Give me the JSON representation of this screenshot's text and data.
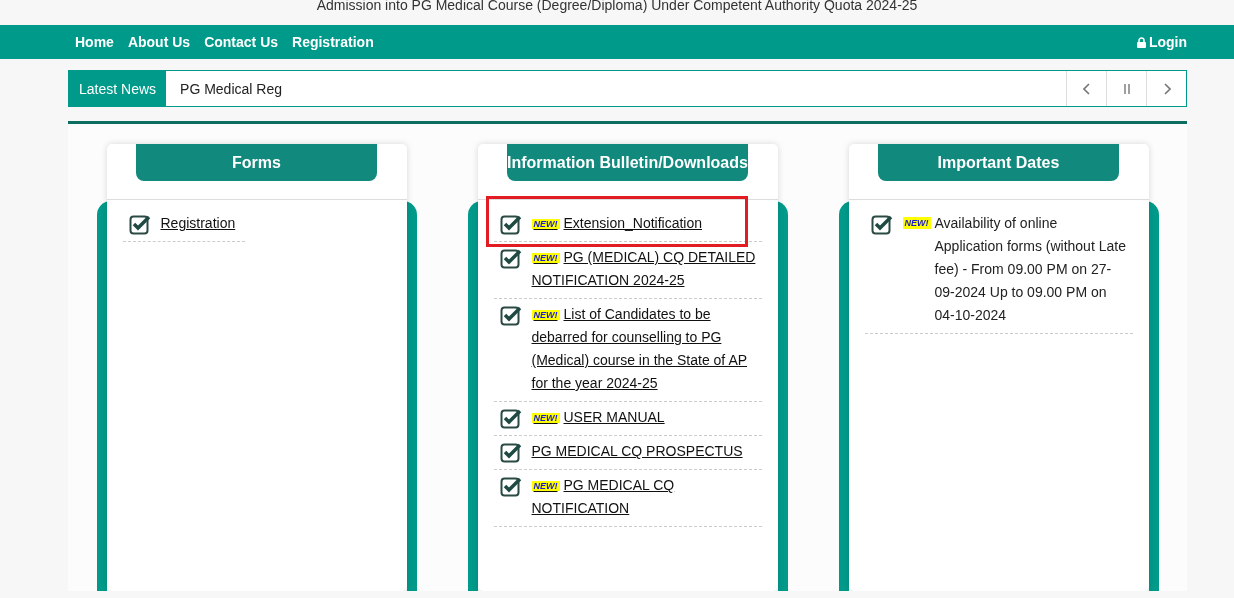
{
  "page_title": "Admission into PG Medical Course (Degree/Diploma) Under Competent Authority Quota 2024-25",
  "nav": {
    "links": [
      "Home",
      "About Us",
      "Contact Us",
      "Registration"
    ],
    "login": "Login"
  },
  "news": {
    "label": "Latest News",
    "text": "PG Medical Reg",
    "controls": [
      {
        "kind": "prev"
      },
      {
        "kind": "pause"
      },
      {
        "kind": "next"
      }
    ]
  },
  "cards": [
    {
      "title": "Forms",
      "items": [
        {
          "text": "Registration",
          "link": true,
          "highlighted": false
        }
      ]
    },
    {
      "title": "Information Bulletin/Downloads",
      "items": [
        {
          "text": "Extension_Notification",
          "link": true,
          "badge": "NEW!",
          "highlighted": true
        },
        {
          "text": "PG (MEDICAL) CQ DETAILED NOTIFICATION 2024-25",
          "link": true,
          "badge": "NEW!",
          "highlighted": false
        },
        {
          "text": "List of Candidates to be debarred for counselling to PG (Medical) course in the State of AP for the year 2024-25",
          "link": true,
          "badge": "NEW!",
          "highlighted": false
        },
        {
          "text": "USER MANUAL",
          "link": true,
          "badge": "NEW!",
          "highlighted": false
        },
        {
          "text": "PG MEDICAL CQ PROSPECTUS",
          "link": true,
          "highlighted": false
        },
        {
          "text": "PG MEDICAL CQ NOTIFICATION",
          "link": true,
          "badge": "NEW!",
          "highlighted": false
        }
      ]
    },
    {
      "title": "Important Dates",
      "items": [
        {
          "text": "Availability of online Application forms (without Late fee) - From 09.00 PM on 27-09-2024 Up to 09.00 PM on 04-10-2024",
          "link": false,
          "badge": "NEW!",
          "highlighted": false
        }
      ]
    }
  ]
}
